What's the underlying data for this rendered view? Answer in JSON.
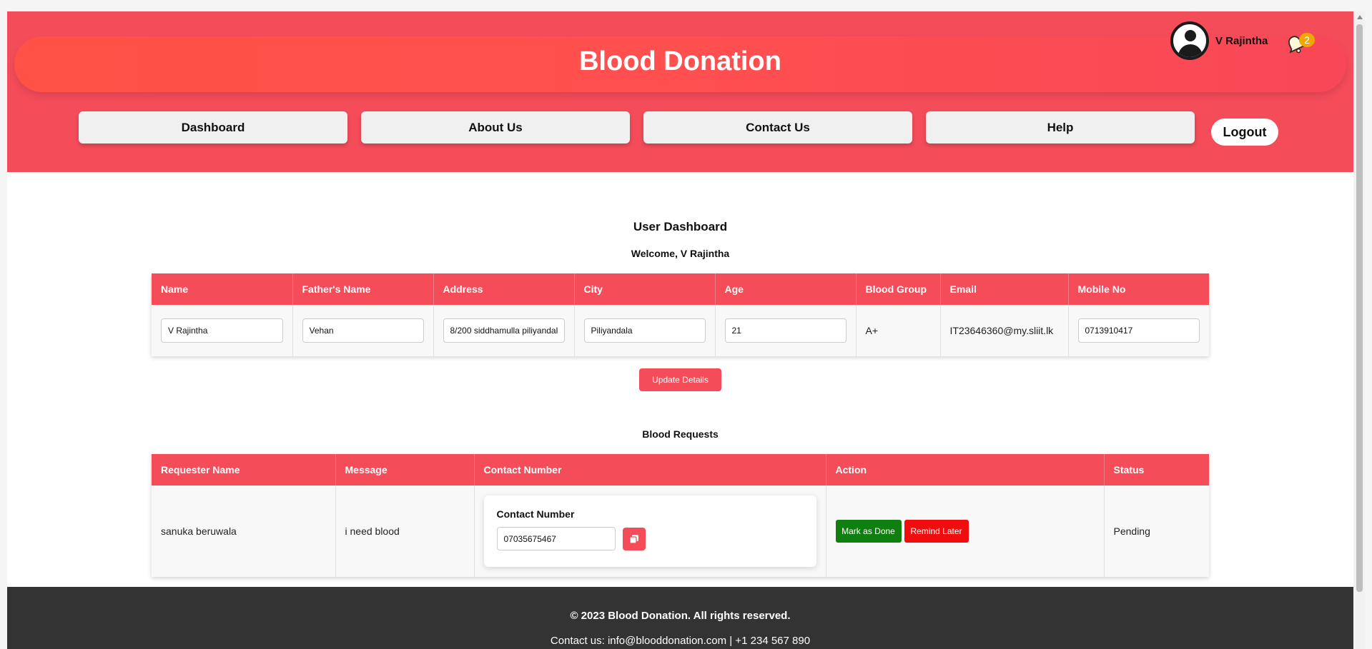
{
  "header": {
    "title": "Blood Donation",
    "user_name": "V Rajintha",
    "notification_count": "2",
    "nav": [
      "Dashboard",
      "About Us",
      "Contact Us",
      "Help"
    ],
    "logout_label": "Logout"
  },
  "dashboard": {
    "title": "User Dashboard",
    "welcome": "Welcome, V Rajintha",
    "columns": [
      "Name",
      "Father's Name",
      "Address",
      "City",
      "Age",
      "Blood Group",
      "Email",
      "Mobile No"
    ],
    "user": {
      "name": "V Rajintha",
      "father_name": "Vehan",
      "address": "8/200 siddhamulla piliyandal",
      "city": "Piliyandala",
      "age": "21",
      "blood_group": "A+",
      "email": "IT23646360@my.sliit.lk",
      "mobile": "0713910417"
    },
    "update_label": "Update Details"
  },
  "requests": {
    "title": "Blood Requests",
    "columns": [
      "Requester Name",
      "Message",
      "Contact Number",
      "Action",
      "Status"
    ],
    "rows": [
      {
        "requester": "sanuka beruwala",
        "message": "i need blood",
        "contact_label": "Contact Number",
        "contact_number": "07035675467",
        "done_label": "Mark as Done",
        "remind_label": "Remind Later",
        "status": "Pending"
      }
    ]
  },
  "footer": {
    "copyright": "© 2023 Blood Donation. All rights reserved.",
    "contact": "Contact us: info@blooddonation.com | +1 234 567 890"
  },
  "colors": {
    "primary": "#f54c5a",
    "done": "#0f7f0f",
    "remind": "#ef0d0d",
    "footer": "#333333",
    "badge": "#f0a800"
  },
  "icons": [
    "user-avatar-icon",
    "bell-icon",
    "copy-icon"
  ]
}
